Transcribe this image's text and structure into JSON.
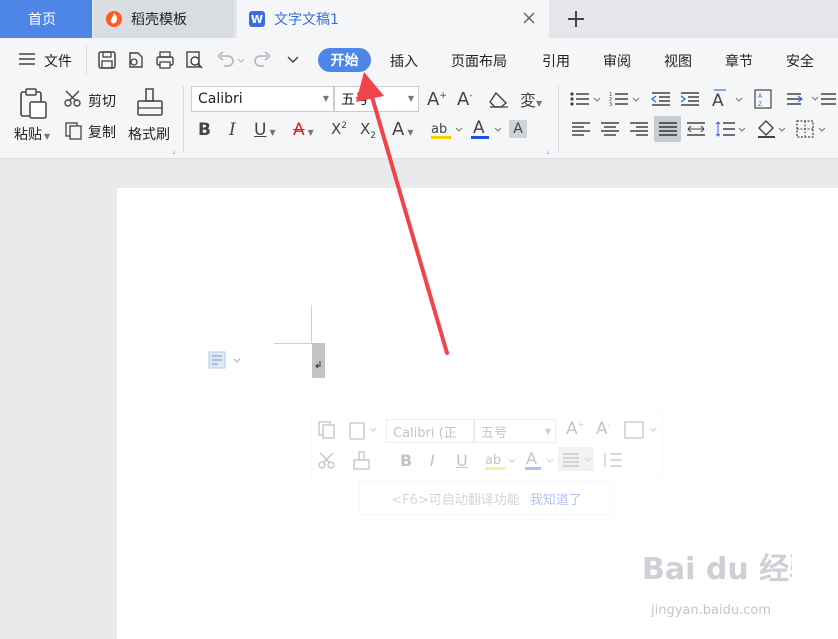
{
  "tabs": {
    "home": "首页",
    "template": "稻壳模板",
    "document": "文字文稿1",
    "doc_icon_letter": "W"
  },
  "toolbar": {
    "file_menu": "文件"
  },
  "menus": [
    "开始",
    "插入",
    "页面布局",
    "引用",
    "审阅",
    "视图",
    "章节",
    "安全"
  ],
  "clipboard": {
    "paste": "粘贴",
    "cut": "剪切",
    "copy": "复制",
    "format_painter": "格式刷"
  },
  "font": {
    "name": "Calibri",
    "size": "五号"
  },
  "floating_toolbar": {
    "font_name": "Calibri (正",
    "font_size": "五号"
  },
  "hint": {
    "text": "<F6>可启动翻译功能",
    "link": "我知道了"
  },
  "watermark": {
    "logo": "Bai du 经验",
    "url": "jingyan.baidu.com"
  },
  "colors": {
    "accent": "#4d86e6",
    "arrow": "#f0444a",
    "highlight_yellow": "#f5d000",
    "font_red": "#e02020",
    "font_blue": "#2050e0"
  }
}
